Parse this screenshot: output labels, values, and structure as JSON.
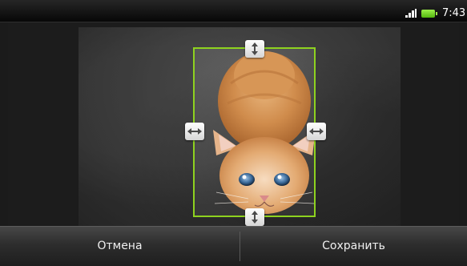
{
  "status_bar": {
    "time": "7:43",
    "signal_icon": "signal-bars-icon",
    "battery_icon": "battery-icon",
    "battery_color": "#6cd41b"
  },
  "editor": {
    "crop_frame_color": "#8ed21f",
    "handle_icons": {
      "top": "resize-vertical-icon",
      "bottom": "resize-vertical-icon",
      "left": "resize-horizontal-icon",
      "right": "resize-horizontal-icon"
    }
  },
  "actions": {
    "cancel_label": "Отмена",
    "save_label": "Сохранить"
  }
}
